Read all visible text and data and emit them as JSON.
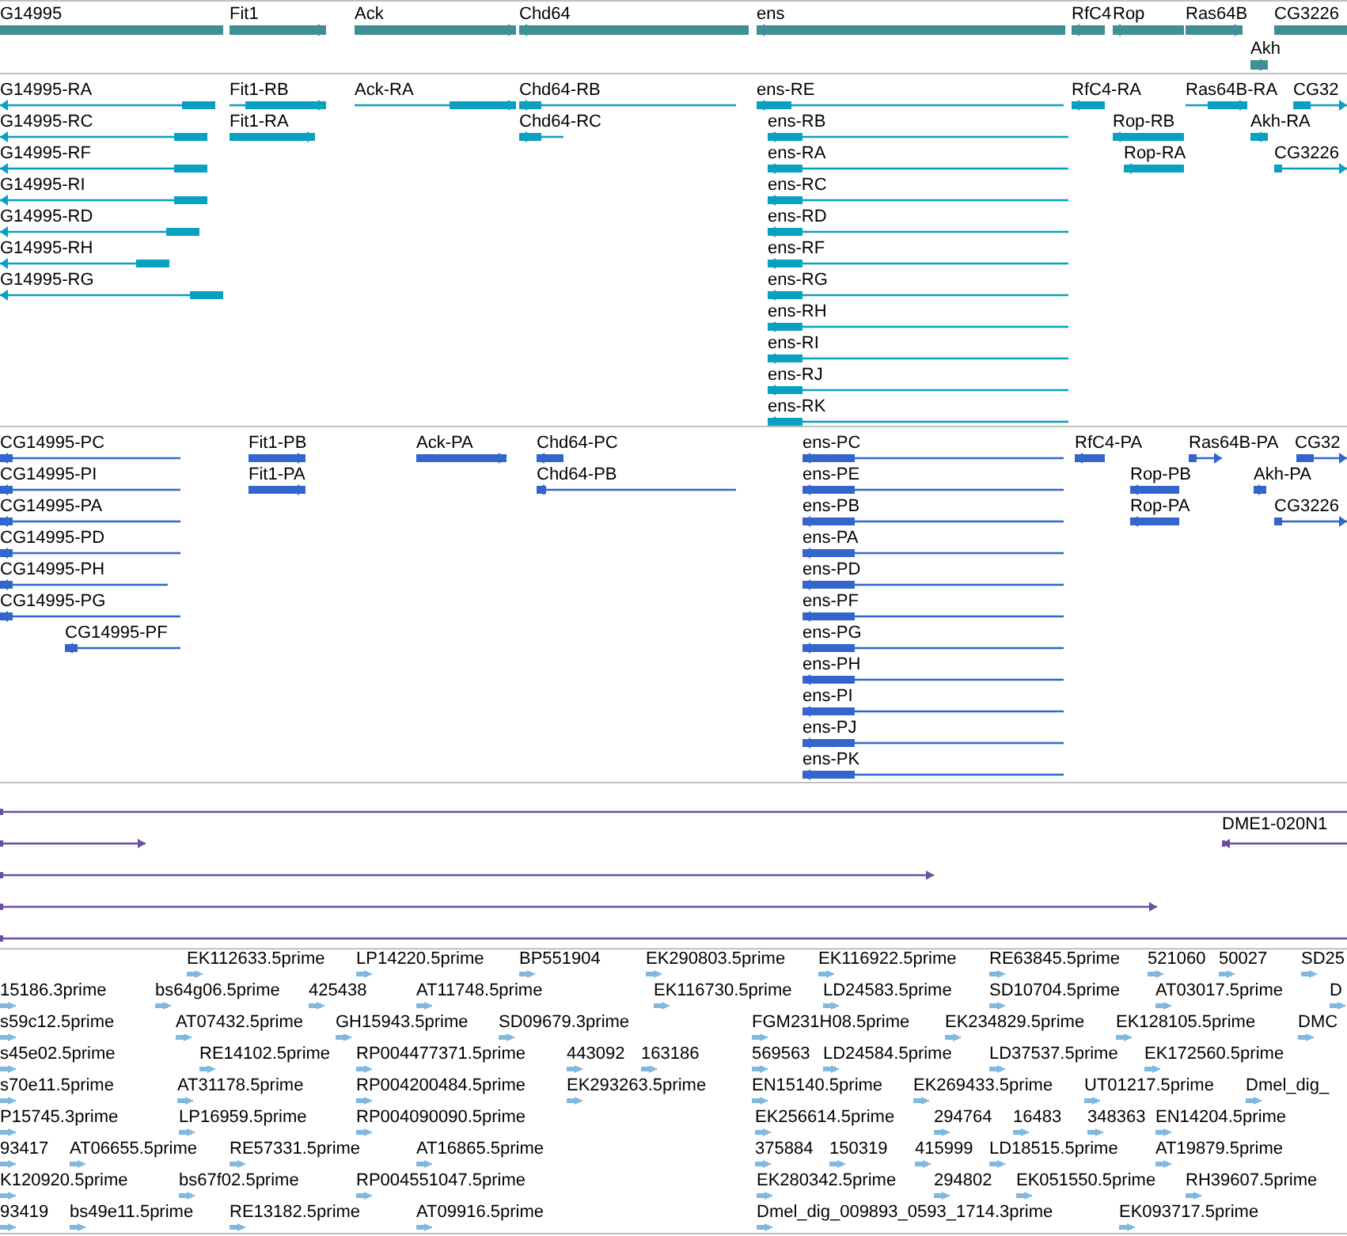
{
  "tracks": [
    {
      "kind": "gene",
      "features": [
        {
          "label": "G14995"
        },
        {
          "label": "Fit1"
        },
        {
          "label": "Ack"
        },
        {
          "label": "Chd64"
        },
        {
          "label": "ens"
        },
        {
          "label": "RfC4"
        },
        {
          "label": "Rop"
        },
        {
          "label": "Ras64B"
        },
        {
          "label": "CG3226"
        },
        {
          "label": "Akh"
        }
      ]
    },
    {
      "kind": "transcript",
      "features": [
        {
          "label": "G14995-RA"
        },
        {
          "label": "Fit1-RB"
        },
        {
          "label": "Ack-RA"
        },
        {
          "label": "Chd64-RB"
        },
        {
          "label": "ens-RE"
        },
        {
          "label": "RfC4-RA"
        },
        {
          "label": "Ras64B-RA"
        },
        {
          "label": "CG32"
        },
        {
          "label": "G14995-RC"
        },
        {
          "label": "Fit1-RA"
        },
        {
          "label": "Chd64-RC"
        },
        {
          "label": "ens-RB"
        },
        {
          "label": "Rop-RB"
        },
        {
          "label": "Akh-RA"
        },
        {
          "label": "G14995-RF"
        },
        {
          "label": "ens-RA"
        },
        {
          "label": "Rop-RA"
        },
        {
          "label": "CG3226"
        },
        {
          "label": "G14995-RI"
        },
        {
          "label": "ens-RC"
        },
        {
          "label": "G14995-RD"
        },
        {
          "label": "ens-RD"
        },
        {
          "label": "G14995-RH"
        },
        {
          "label": "ens-RF"
        },
        {
          "label": "G14995-RG"
        },
        {
          "label": "ens-RG"
        },
        {
          "label": "ens-RH"
        },
        {
          "label": "ens-RI"
        },
        {
          "label": "ens-RJ"
        },
        {
          "label": "ens-RK"
        }
      ]
    },
    {
      "kind": "protein",
      "features": [
        {
          "label": "CG14995-PC"
        },
        {
          "label": "Fit1-PB"
        },
        {
          "label": "Ack-PA"
        },
        {
          "label": "Chd64-PC"
        },
        {
          "label": "ens-PC"
        },
        {
          "label": "RfC4-PA"
        },
        {
          "label": "Ras64B-PA"
        },
        {
          "label": "CG32"
        },
        {
          "label": "CG14995-PI"
        },
        {
          "label": "Fit1-PA"
        },
        {
          "label": "Chd64-PB"
        },
        {
          "label": "ens-PE"
        },
        {
          "label": "Rop-PB"
        },
        {
          "label": "Akh-PA"
        },
        {
          "label": "CG14995-PA"
        },
        {
          "label": "ens-PB"
        },
        {
          "label": "Rop-PA"
        },
        {
          "label": "CG3226"
        },
        {
          "label": "CG14995-PD"
        },
        {
          "label": "ens-PA"
        },
        {
          "label": "CG14995-PH"
        },
        {
          "label": "ens-PD"
        },
        {
          "label": "CG14995-PG"
        },
        {
          "label": "ens-PF"
        },
        {
          "label": "CG14995-PF"
        },
        {
          "label": "ens-PG"
        },
        {
          "label": "ens-PH"
        },
        {
          "label": "ens-PI"
        },
        {
          "label": "ens-PJ"
        },
        {
          "label": "ens-PK"
        }
      ]
    },
    {
      "kind": "alignment",
      "features": [
        {
          "label": "DME1-020N1"
        }
      ]
    },
    {
      "kind": "est",
      "features": [
        {
          "label": "EK112633.5prime"
        },
        {
          "label": "LP14220.5prime"
        },
        {
          "label": "BP551904"
        },
        {
          "label": "EK290803.5prime"
        },
        {
          "label": "EK116922.5prime"
        },
        {
          "label": "RE63845.5prime"
        },
        {
          "label": "521060"
        },
        {
          "label": "50027"
        },
        {
          "label": "SD25"
        },
        {
          "label": "15186.3prime"
        },
        {
          "label": "bs64g06.5prime"
        },
        {
          "label": "425438"
        },
        {
          "label": "AT11748.5prime"
        },
        {
          "label": "EK116730.5prime"
        },
        {
          "label": "LD24583.5prime"
        },
        {
          "label": "SD10704.5prime"
        },
        {
          "label": "AT03017.5prime"
        },
        {
          "label": "D"
        },
        {
          "label": "s59c12.5prime"
        },
        {
          "label": "AT07432.5prime"
        },
        {
          "label": "GH15943.5prime"
        },
        {
          "label": "SD09679.3prime"
        },
        {
          "label": "FGM231H08.5prime"
        },
        {
          "label": "EK234829.5prime"
        },
        {
          "label": "EK128105.5prime"
        },
        {
          "label": "DMC"
        },
        {
          "label": "s45e02.5prime"
        },
        {
          "label": "RE14102.5prime"
        },
        {
          "label": "RP004477371.5prime"
        },
        {
          "label": "443092"
        },
        {
          "label": "163186"
        },
        {
          "label": "569563"
        },
        {
          "label": "LD24584.5prime"
        },
        {
          "label": "LD37537.5prime"
        },
        {
          "label": "EK172560.5prime"
        },
        {
          "label": "s70e11.5prime"
        },
        {
          "label": "AT31178.5prime"
        },
        {
          "label": "RP004200484.5prime"
        },
        {
          "label": "EK293263.5prime"
        },
        {
          "label": "EN15140.5prime"
        },
        {
          "label": "EK269433.5prime"
        },
        {
          "label": "UT01217.5prime"
        },
        {
          "label": "Dmel_dig_"
        },
        {
          "label": "P15745.3prime"
        },
        {
          "label": "LP16959.5prime"
        },
        {
          "label": "RP004090090.5prime"
        },
        {
          "label": "EK256614.5prime"
        },
        {
          "label": "294764"
        },
        {
          "label": "16483"
        },
        {
          "label": "348363"
        },
        {
          "label": "EN14204.5prime"
        },
        {
          "label": "93417"
        },
        {
          "label": "AT06655.5prime"
        },
        {
          "label": "RE57331.5prime"
        },
        {
          "label": "AT16865.5prime"
        },
        {
          "label": "375884"
        },
        {
          "label": "150319"
        },
        {
          "label": "415999"
        },
        {
          "label": "LD18515.5prime"
        },
        {
          "label": "AT19879.5prime"
        },
        {
          "label": "K120920.5prime"
        },
        {
          "label": "bs67f02.5prime"
        },
        {
          "label": "RP004551047.5prime"
        },
        {
          "label": "EK280342.5prime"
        },
        {
          "label": "294802"
        },
        {
          "label": "EK051550.5prime"
        },
        {
          "label": "RH39607.5prime"
        },
        {
          "label": "93419"
        },
        {
          "label": "bs49e11.5prime"
        },
        {
          "label": "RE13182.5prime"
        },
        {
          "label": "AT09916.5prime"
        },
        {
          "label": "Dmel_dig_009893_0593_1714.3prime"
        },
        {
          "label": "EK093717.5prime"
        }
      ]
    }
  ]
}
